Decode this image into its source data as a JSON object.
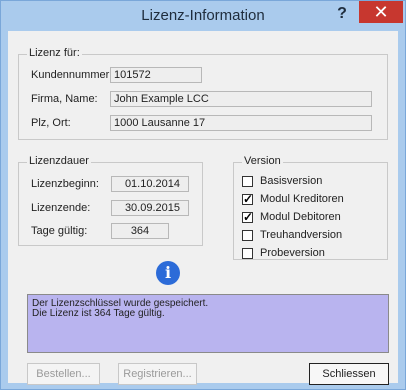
{
  "window": {
    "title": "Lizenz-Information",
    "help_label": "?",
    "close_label": "✕"
  },
  "license_for": {
    "title": "Lizenz für:",
    "rows": [
      {
        "label": "Kundennummer:",
        "value": "101572"
      },
      {
        "label": "Firma, Name:",
        "value": "John Example LCC"
      },
      {
        "label": "Plz, Ort:",
        "value": "1000 Lausanne 17"
      }
    ]
  },
  "duration": {
    "title": "Lizenzdauer",
    "rows": [
      {
        "label": "Lizenzbeginn:",
        "value": "01.10.2014"
      },
      {
        "label": "Lizenzende:",
        "value": "30.09.2015"
      },
      {
        "label": "Tage gültig:",
        "value": "364"
      }
    ]
  },
  "version": {
    "title": "Version",
    "options": [
      {
        "label": "Basisversion",
        "checked": false,
        "mark": ""
      },
      {
        "label": "Modul Kreditoren",
        "checked": true,
        "mark": "✓"
      },
      {
        "label": "Modul Debitoren",
        "checked": true,
        "mark": "✓"
      },
      {
        "label": "Treuhandversion",
        "checked": false,
        "mark": ""
      },
      {
        "label": "Probeversion",
        "checked": false,
        "mark": ""
      }
    ]
  },
  "info_icon_glyph": "i",
  "message": {
    "line1": "Der Lizenzschlüssel wurde gespeichert.",
    "line2": "Die Lizenz ist 364 Tage gültig."
  },
  "buttons": {
    "order": "Bestellen...",
    "register": "Registrieren...",
    "close": "Schliessen"
  }
}
